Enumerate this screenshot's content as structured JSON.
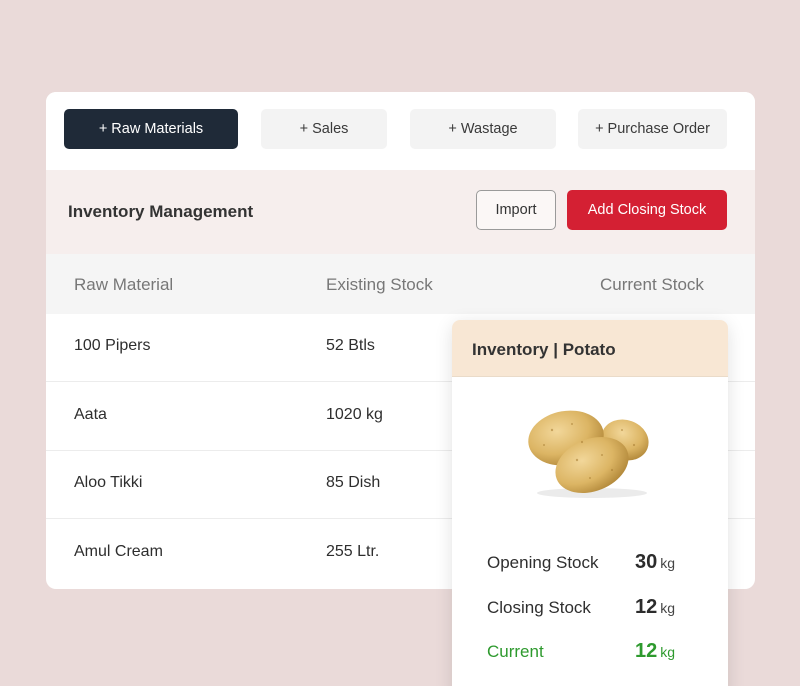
{
  "tabs": [
    {
      "label": "+ Raw Materials",
      "active": true
    },
    {
      "label": "+ Sales",
      "active": false
    },
    {
      "label": "+ Wastage",
      "active": false
    },
    {
      "label": "+ Purchase Order",
      "active": false
    }
  ],
  "header": {
    "title": "Inventory Management",
    "import_label": "Import",
    "add_label": "Add Closing Stock"
  },
  "table": {
    "columns": [
      "Raw Material",
      "Existing Stock",
      "Current Stock"
    ],
    "rows": [
      {
        "material": "100 Pipers",
        "existing": "52 Btls"
      },
      {
        "material": "Aata",
        "existing": "1020 kg"
      },
      {
        "material": "Aloo Tikki",
        "existing": "85 Dish"
      },
      {
        "material": "Amul Cream",
        "existing": "255 Ltr."
      }
    ]
  },
  "popup": {
    "title": "Inventory | Potato",
    "image_icon": "potato-image",
    "stats": [
      {
        "label": "Opening Stock",
        "value": "30",
        "unit": "kg"
      },
      {
        "label": "Closing Stock",
        "value": "12",
        "unit": "kg"
      },
      {
        "label": "Current",
        "value": "12",
        "unit": "kg"
      }
    ]
  },
  "colors": {
    "background": "#eadad9",
    "active_tab": "#1f2a38",
    "primary_button": "#d42033",
    "popup_header": "#f8e7d4",
    "current_green": "#2e9a2e"
  }
}
